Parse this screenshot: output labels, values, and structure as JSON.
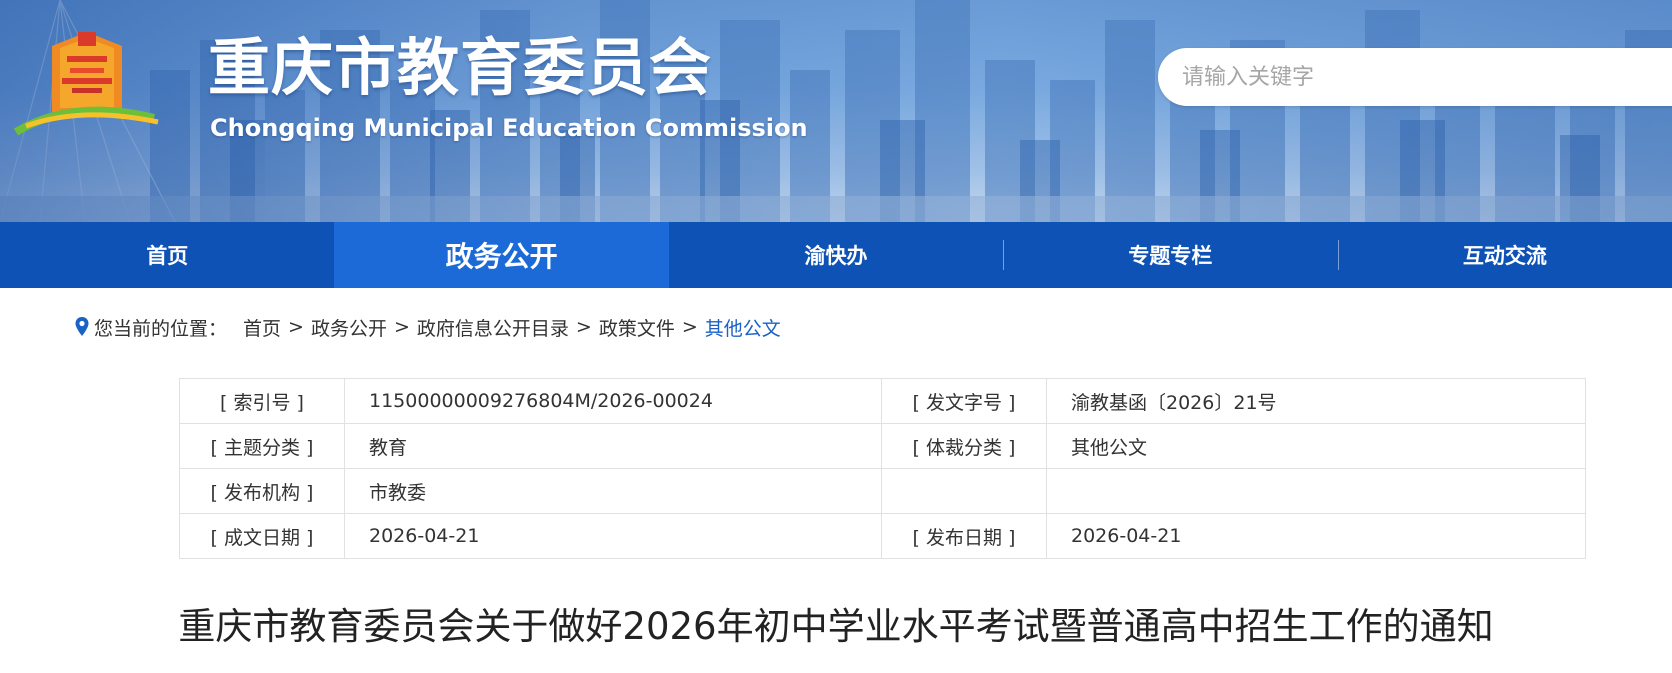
{
  "header": {
    "title": "重庆市教育委员会",
    "subtitle": "Chongqing Municipal Education Commission",
    "logo_icon": "chongqing-edu-logo-icon",
    "search": {
      "placeholder": "请输入关键字",
      "value": ""
    }
  },
  "nav": {
    "items": [
      {
        "label": "首页",
        "active": false
      },
      {
        "label": "政务公开",
        "active": true
      },
      {
        "label": "渝快办",
        "active": false
      },
      {
        "label": "专题专栏",
        "active": false
      },
      {
        "label": "互动交流",
        "active": false
      }
    ]
  },
  "breadcrumb": {
    "label": "您当前的位置：",
    "icon": "location-pin-icon",
    "items": [
      "首页",
      "政务公开",
      "政府信息公开目录",
      "政策文件",
      "其他公文"
    ],
    "separator": ">"
  },
  "info": {
    "rows": [
      {
        "k1": "[ 索引号 ]",
        "v1": "11500000009276804M/2026-00024",
        "k2": "[ 发文字号 ]",
        "v2": "渝教基函〔2026〕21号"
      },
      {
        "k1": "[ 主题分类 ]",
        "v1": "教育",
        "k2": "[ 体裁分类 ]",
        "v2": "其他公文"
      },
      {
        "k1": "[ 发布机构 ]",
        "v1": "市教委",
        "k2": "",
        "v2": ""
      },
      {
        "k1": "[ 成文日期 ]",
        "v1": "2026-04-21",
        "k2": "[ 发布日期 ]",
        "v2": "2026-04-21"
      }
    ]
  },
  "article": {
    "title": "重庆市教育委员会关于做好2026年初中学业水平考试暨普通高中招生工作的通知"
  },
  "colors": {
    "nav_bg": "#0e52b5",
    "nav_active": "#1c6ad7",
    "link_current": "#1a62c6"
  }
}
